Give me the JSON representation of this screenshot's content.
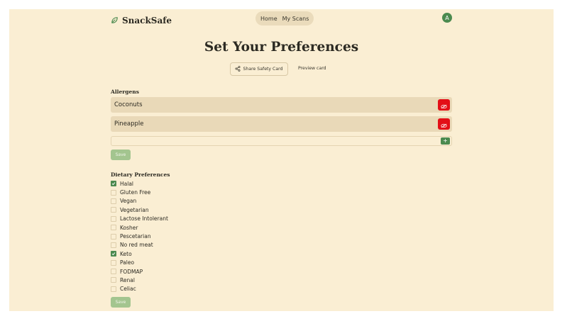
{
  "header": {
    "app_title": "SnackSafe",
    "nav": [
      {
        "label": "Home"
      },
      {
        "label": "My Scans"
      }
    ],
    "avatar_initial": "A"
  },
  "page": {
    "title": "Set Your Preferences",
    "share_label": "Share Safety Card",
    "preview_label": "Preview card"
  },
  "allergens": {
    "title": "Allergens",
    "items": [
      {
        "label": "Coconuts"
      },
      {
        "label": "Pineapple"
      }
    ],
    "add_input": {
      "value": "",
      "placeholder": ""
    },
    "add_label": "+",
    "save_label": "Save"
  },
  "dietary": {
    "title": "Dietary Preferences",
    "items": [
      {
        "label": "Halal",
        "checked": true
      },
      {
        "label": "Gluten Free",
        "checked": false
      },
      {
        "label": "Vegan",
        "checked": false
      },
      {
        "label": "Vegetarian",
        "checked": false
      },
      {
        "label": "Lactose Intolerant",
        "checked": false
      },
      {
        "label": "Kosher",
        "checked": false
      },
      {
        "label": "Pescetarian",
        "checked": false
      },
      {
        "label": "No red meat",
        "checked": false
      },
      {
        "label": "Keto",
        "checked": true
      },
      {
        "label": "Paleo",
        "checked": false
      },
      {
        "label": "FODMAP",
        "checked": false
      },
      {
        "label": "Renal",
        "checked": false
      },
      {
        "label": "Celiac",
        "checked": false
      }
    ],
    "save_label": "Save"
  },
  "colors": {
    "background": "#faeed3",
    "accent_green": "#4b8a4f",
    "danger_red": "#e30f17",
    "row_tan": "#e9d9b8",
    "disabled_green": "#a3c58f"
  },
  "icons": {
    "logo": "leaf-icon",
    "share": "share-icon",
    "remove": "eye-off-icon",
    "check": "check-icon"
  }
}
